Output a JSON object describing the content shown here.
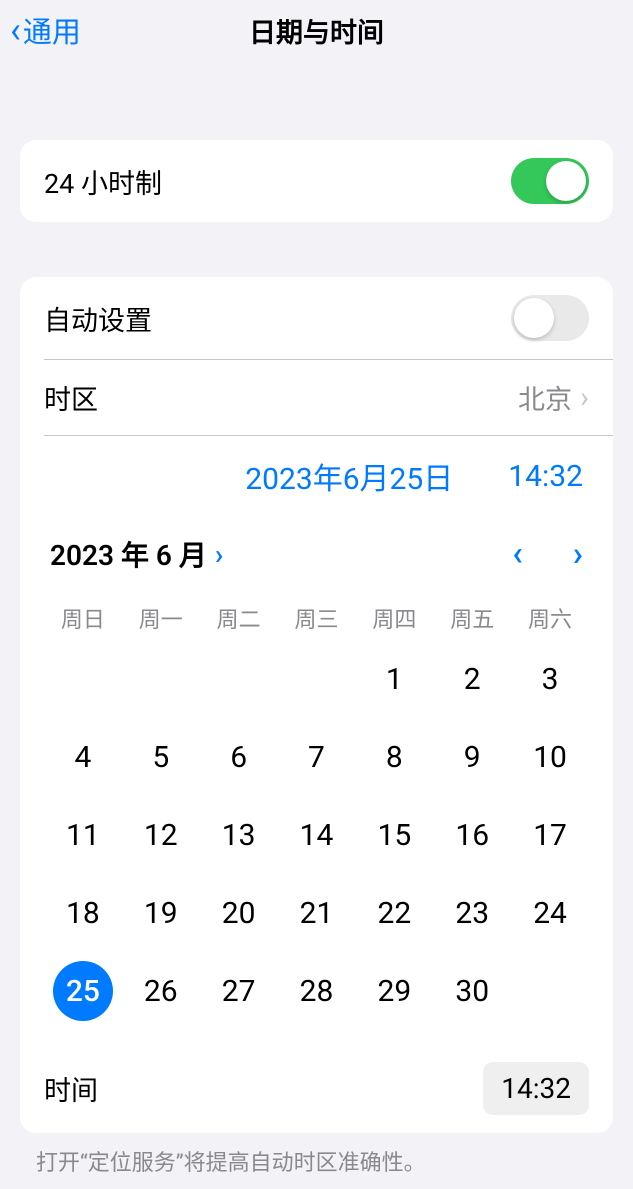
{
  "nav": {
    "back": "通用",
    "title": "日期与时间"
  },
  "h24": {
    "label": "24 小时制",
    "on": true
  },
  "auto": {
    "label": "自动设置",
    "on": false
  },
  "tz": {
    "label": "时区",
    "value": "北京"
  },
  "picker": {
    "date": "2023年6月25日",
    "time": "14:32"
  },
  "month": {
    "label": "2023 年 6 月"
  },
  "dow": [
    "周日",
    "周一",
    "周二",
    "周三",
    "周四",
    "周五",
    "周六"
  ],
  "calendar": {
    "startOffset": 4,
    "days": 30,
    "selected": 25
  },
  "time": {
    "label": "时间",
    "value": "14:32"
  },
  "foot": "打开“定位服务”将提高自动时区准确性。"
}
